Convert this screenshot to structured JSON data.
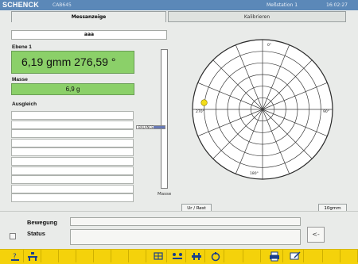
{
  "titlebar": {
    "logo": "SCHENCK",
    "model": "CAB645",
    "station": "Meßstation 1",
    "time": "16:02:27"
  },
  "tabs": {
    "active": "Messanzeige",
    "inactive": "Kalibrieren"
  },
  "part_id": "aaa",
  "ebene": {
    "label": "Ebene 1",
    "value": "6,19 gmm 276,59 °"
  },
  "masse": {
    "label": "Masse",
    "value": "6,9 g"
  },
  "ausgleich": {
    "label": "Ausgleich"
  },
  "slider": {
    "label": "Masse",
    "marker_label": "BALANCE",
    "level": 0.44
  },
  "polar": {
    "angle_labels": [
      "0°",
      "90°",
      "180°",
      "270°"
    ],
    "point": {
      "radius_fraction": 0.84,
      "angle_deg": 276.59,
      "color": "#f2dc1a"
    }
  },
  "buttons": {
    "urrest": "Ur / Rest",
    "scale": "10gmm",
    "arrow": "<-"
  },
  "bottom": {
    "bewegung_label": "Bewegung",
    "status_label": "Status"
  },
  "colors": {
    "title_bg": "#5b88b8",
    "value_green": "#8bd069",
    "toolbar_yellow": "#f4d20b"
  }
}
